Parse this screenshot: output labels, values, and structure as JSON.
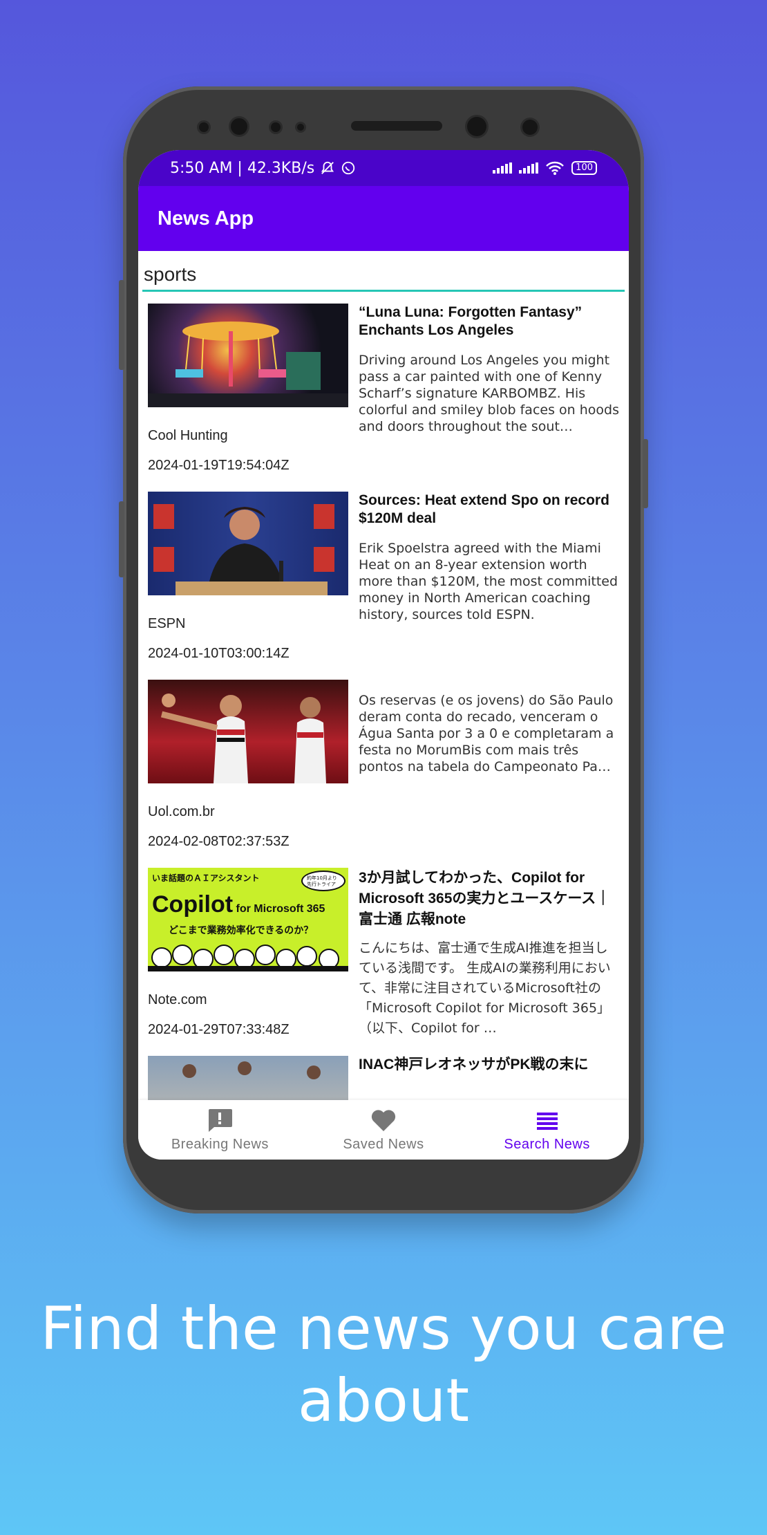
{
  "status": {
    "time_speed": "5:50 AM | 42.3KB/s",
    "battery": "100"
  },
  "app": {
    "title": "News App"
  },
  "search": {
    "value": "sports"
  },
  "articles": [
    {
      "title": "“Luna Luna: Forgotten Fantasy” Enchants Los Angeles",
      "description": "Driving around Los Angeles you might pass a car painted with one of Kenny Scharf’s signature KARBOMBZ. His colorful and smiley blob faces on hoods and doors throughout the sout…",
      "source": "Cool Hunting",
      "date": "2024-01-19T19:54:04Z"
    },
    {
      "title": "Sources: Heat extend Spo on record $120M deal",
      "description": "Erik Spoelstra agreed with the Miami Heat on an 8-year extension worth more than $120M, the most committed money in North American coaching history, sources told ESPN.",
      "source": "ESPN",
      "date": "2024-01-10T03:00:14Z"
    },
    {
      "title": "",
      "description": "Os reservas (e os jovens) do São Paulo deram conta do recado, venceram o Água Santa por 3 a 0 e completaram a festa no MorumBis com mais três pontos na tabela do Campeonato Pa…",
      "source": "Uol.com.br",
      "date": "2024-02-08T02:37:53Z"
    },
    {
      "title": "3か月試してわかった、Copilot for Microsoft 365の実力とユースケース｜富士通 広報note",
      "description": "こんにちは、富士通で生成AI推進を担当している浅間です。 生成AIの業務利用において、非常に注目されているMicrosoft社の「Microsoft Copilot for Microsoft 365」（以下、Copilot for …",
      "source": "Note.com",
      "date": "2024-01-29T07:33:48Z"
    },
    {
      "title": "INAC神戸レオネッサがPK戦の末に",
      "description": "",
      "source": "",
      "date": ""
    }
  ],
  "thumb4": {
    "line1": "いま話題のＡＩアシスタント",
    "brand": "Copilot",
    "brand_small": "for Microsoft 365",
    "line3": "どこまで業務効率化できるのか？",
    "badge": "約年10月より先行トライアル"
  },
  "nav": [
    {
      "label": "Breaking News",
      "icon": "alert-icon",
      "active": false
    },
    {
      "label": "Saved News",
      "icon": "heart-icon",
      "active": false
    },
    {
      "label": "Search News",
      "icon": "menu-icon",
      "active": true
    }
  ],
  "tagline": "Find the news you care about",
  "colors": {
    "status_bar": "#4a04c9",
    "app_bar": "#6200ee",
    "accent": "#26c6b5",
    "active_nav": "#6200ee"
  }
}
